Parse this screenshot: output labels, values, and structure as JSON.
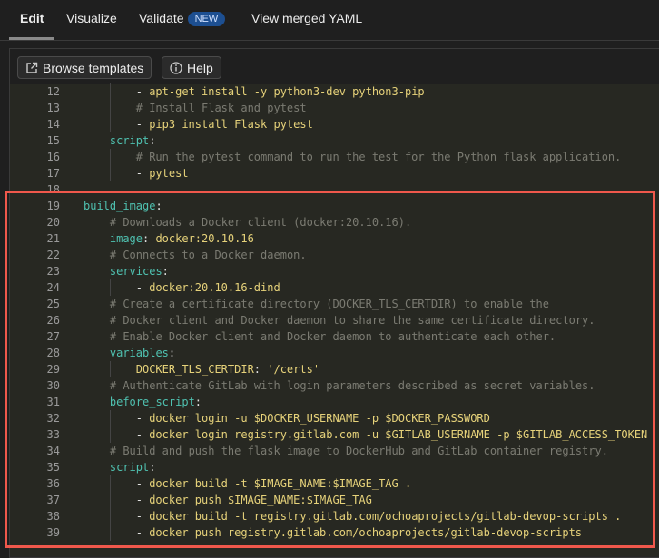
{
  "tabs": [
    {
      "label": "Edit",
      "active": true
    },
    {
      "label": "Visualize"
    },
    {
      "label": "Validate",
      "badge": "NEW"
    },
    {
      "label": "View merged YAML"
    }
  ],
  "toolbar": {
    "browse_templates": "Browse templates",
    "help": "Help"
  },
  "colors": {
    "key": "#4fc1b0",
    "string": "#e6d27a",
    "comment": "#7b7b72",
    "highlight": "#f0584c"
  },
  "code_lines": [
    {
      "n": "12",
      "indent": 8,
      "tokens": [
        [
          "p",
          "- "
        ],
        [
          "s",
          "apt-get install -y python3-dev python3-pip"
        ]
      ]
    },
    {
      "n": "13",
      "indent": 8,
      "tokens": [
        [
          "c",
          "# Install Flask and pytest"
        ]
      ]
    },
    {
      "n": "14",
      "indent": 8,
      "tokens": [
        [
          "p",
          "- "
        ],
        [
          "s",
          "pip3 install Flask pytest"
        ]
      ]
    },
    {
      "n": "15",
      "indent": 4,
      "tokens": [
        [
          "k",
          "script"
        ],
        [
          "p",
          ":"
        ]
      ]
    },
    {
      "n": "16",
      "indent": 8,
      "tokens": [
        [
          "c",
          "# Run the pytest command to run the test for the Python flask application."
        ]
      ]
    },
    {
      "n": "17",
      "indent": 8,
      "tokens": [
        [
          "p",
          "- "
        ],
        [
          "s",
          "pytest"
        ]
      ]
    },
    {
      "n": "18",
      "indent": 0,
      "tokens": []
    },
    {
      "n": "19",
      "indent": 0,
      "tokens": [
        [
          "k",
          "build_image"
        ],
        [
          "p",
          ":"
        ]
      ]
    },
    {
      "n": "20",
      "indent": 4,
      "tokens": [
        [
          "c",
          "# Downloads a Docker client (docker:20.10.16)."
        ]
      ]
    },
    {
      "n": "21",
      "indent": 4,
      "tokens": [
        [
          "k",
          "image"
        ],
        [
          "p",
          ": "
        ],
        [
          "s",
          "docker:20.10.16"
        ]
      ]
    },
    {
      "n": "22",
      "indent": 4,
      "tokens": [
        [
          "c",
          "# Connects to a Docker daemon."
        ]
      ]
    },
    {
      "n": "23",
      "indent": 4,
      "tokens": [
        [
          "k",
          "services"
        ],
        [
          "p",
          ":"
        ]
      ]
    },
    {
      "n": "24",
      "indent": 8,
      "tokens": [
        [
          "p",
          "- "
        ],
        [
          "s",
          "docker:20.10.16-dind"
        ]
      ]
    },
    {
      "n": "25",
      "indent": 4,
      "tokens": [
        [
          "c",
          "# Create a certificate directory (DOCKER_TLS_CERTDIR) to enable the"
        ]
      ]
    },
    {
      "n": "26",
      "indent": 4,
      "tokens": [
        [
          "c",
          "# Docker client and Docker daemon to share the same certificate directory."
        ]
      ]
    },
    {
      "n": "27",
      "indent": 4,
      "tokens": [
        [
          "c",
          "# Enable Docker client and Docker daemon to authenticate each other."
        ]
      ]
    },
    {
      "n": "28",
      "indent": 4,
      "tokens": [
        [
          "k",
          "variables"
        ],
        [
          "p",
          ":"
        ]
      ]
    },
    {
      "n": "29",
      "indent": 8,
      "tokens": [
        [
          "s",
          "DOCKER_TLS_CERTDIR"
        ],
        [
          "p",
          ": "
        ],
        [
          "s",
          "'/certs'"
        ]
      ]
    },
    {
      "n": "30",
      "indent": 4,
      "tokens": [
        [
          "c",
          "# Authenticate GitLab with login parameters described as secret variables."
        ]
      ]
    },
    {
      "n": "31",
      "indent": 4,
      "tokens": [
        [
          "k",
          "before_script"
        ],
        [
          "p",
          ":"
        ]
      ]
    },
    {
      "n": "32",
      "indent": 8,
      "tokens": [
        [
          "p",
          "- "
        ],
        [
          "s",
          "docker login -u $DOCKER_USERNAME -p $DOCKER_PASSWORD"
        ]
      ]
    },
    {
      "n": "33",
      "indent": 8,
      "tokens": [
        [
          "p",
          "- "
        ],
        [
          "s",
          "docker login registry.gitlab.com -u $GITLAB_USERNAME -p $GITLAB_ACCESS_TOKEN"
        ]
      ]
    },
    {
      "n": "34",
      "indent": 4,
      "tokens": [
        [
          "c",
          "# Build and push the flask image to DockerHub and GitLab container registry."
        ]
      ]
    },
    {
      "n": "35",
      "indent": 4,
      "tokens": [
        [
          "k",
          "script"
        ],
        [
          "p",
          ":"
        ]
      ]
    },
    {
      "n": "36",
      "indent": 8,
      "tokens": [
        [
          "p",
          "- "
        ],
        [
          "s",
          "docker build -t $IMAGE_NAME:$IMAGE_TAG ."
        ]
      ]
    },
    {
      "n": "37",
      "indent": 8,
      "tokens": [
        [
          "p",
          "- "
        ],
        [
          "s",
          "docker push $IMAGE_NAME:$IMAGE_TAG"
        ]
      ]
    },
    {
      "n": "38",
      "indent": 8,
      "tokens": [
        [
          "p",
          "- "
        ],
        [
          "s",
          "docker build -t registry.gitlab.com/ochoaprojects/gitlab-devop-scripts ."
        ]
      ]
    },
    {
      "n": "39",
      "indent": 8,
      "tokens": [
        [
          "p",
          "- "
        ],
        [
          "s",
          "docker push registry.gitlab.com/ochoaprojects/gitlab-devop-scripts"
        ]
      ]
    }
  ]
}
